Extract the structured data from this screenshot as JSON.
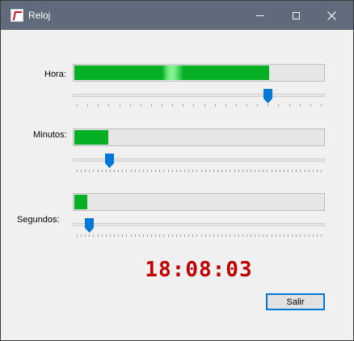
{
  "window": {
    "title": "Reloj"
  },
  "controls": [
    {
      "label": "Hora",
      "label_text": "Hora:",
      "value": 18,
      "max": 23
    },
    {
      "label": "Minutos",
      "label_text": "Minutos:",
      "value": 8,
      "max": 59
    },
    {
      "label": "Segundos",
      "label_text": "Segundos:",
      "value": 3,
      "max": 59
    }
  ],
  "clock": {
    "time": "18:08:03"
  },
  "buttons": {
    "exit_label": "Salir"
  },
  "colors": {
    "titlebar": "#5f6b7b",
    "progress_fill": "#06b025",
    "slider_thumb": "#0078d7",
    "clock_text": "#c00000"
  }
}
